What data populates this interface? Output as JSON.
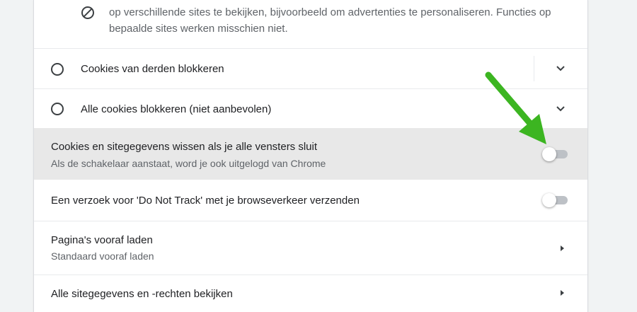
{
  "privacy_block": {
    "icon": "block-icon",
    "description_line1": "op verschillende sites te bekijken, bijvoorbeeld om advertenties te personaliseren. Functies op",
    "description_line2": "bepaalde sites werken misschien niet."
  },
  "options": [
    {
      "label": "Cookies van derden blokkeren",
      "selected": false,
      "icon": "chevron-down-icon"
    },
    {
      "label": "Alle cookies blokkeren (niet aanbevolen)",
      "selected": false,
      "icon": "chevron-down-icon"
    }
  ],
  "clear_on_exit": {
    "title": "Cookies en sitegegevens wissen als je alle vensters sluit",
    "subtitle": "Als de schakelaar aanstaat, word je ook uitgelogd van Chrome",
    "enabled": false
  },
  "do_not_track": {
    "title": "Een verzoek voor 'Do Not Track' met je browseverkeer verzenden",
    "enabled": false
  },
  "preload": {
    "title": "Pagina's vooraf laden",
    "subtitle": "Standaard vooraf laden",
    "icon": "chevron-right-icon"
  },
  "site_data": {
    "title": "Alle sitegegevens en -rechten bekijken",
    "icon": "chevron-right-icon"
  },
  "colors": {
    "page_bg": "#f1f3f4",
    "highlight_row": "#e8e8e8",
    "toggle_track_off": "#bdc1c6",
    "annotation_arrow": "#3cb521"
  }
}
